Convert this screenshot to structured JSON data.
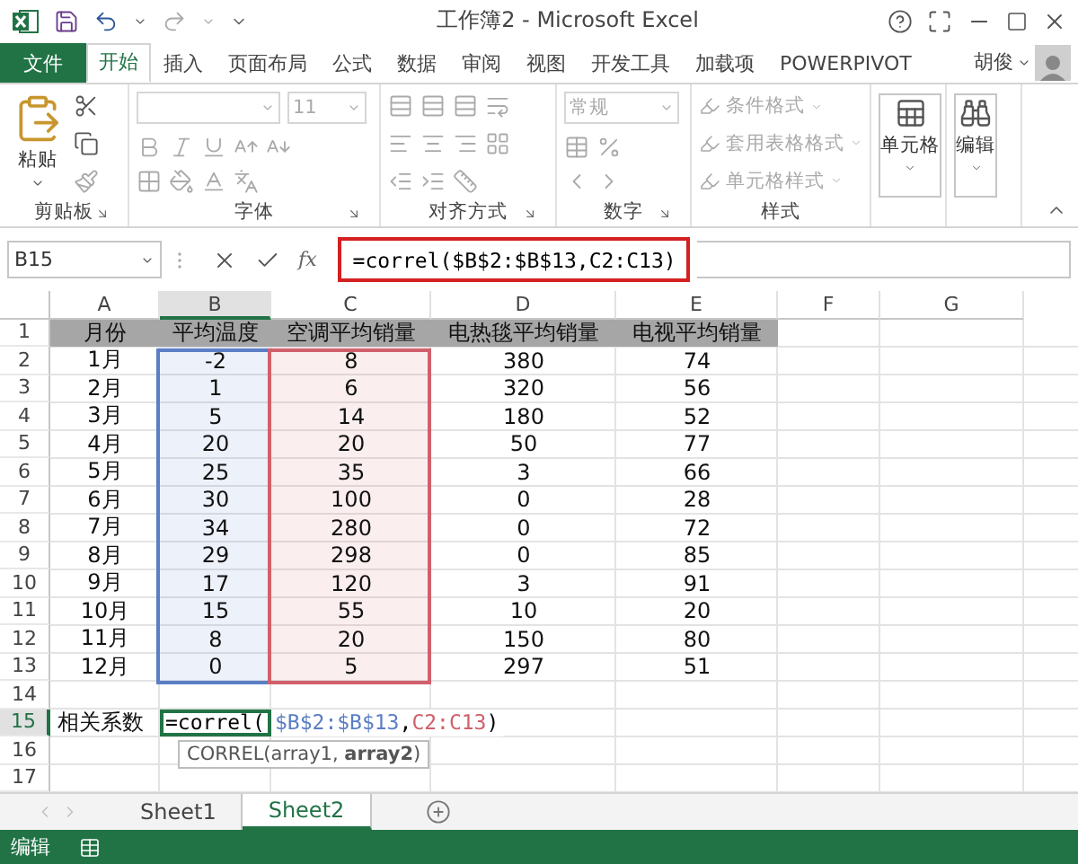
{
  "window": {
    "title": "工作簿2 - Microsoft Excel"
  },
  "ribbon_tabs": [
    {
      "label": "文件",
      "kind": "file",
      "selected": false
    },
    {
      "label": "开始",
      "kind": "tab",
      "selected": true
    },
    {
      "label": "插入",
      "kind": "tab",
      "selected": false
    },
    {
      "label": "页面布局",
      "kind": "tab",
      "selected": false
    },
    {
      "label": "公式",
      "kind": "tab",
      "selected": false
    },
    {
      "label": "数据",
      "kind": "tab",
      "selected": false
    },
    {
      "label": "审阅",
      "kind": "tab",
      "selected": false
    },
    {
      "label": "视图",
      "kind": "tab",
      "selected": false
    },
    {
      "label": "开发工具",
      "kind": "tab",
      "selected": false
    },
    {
      "label": "加载项",
      "kind": "tab",
      "selected": false
    },
    {
      "label": "POWERPIVOT",
      "kind": "tab",
      "selected": false
    }
  ],
  "user": {
    "name": "胡俊"
  },
  "ribbon_groups": [
    {
      "kind": "clipboard",
      "label": "剪贴板",
      "button": "粘贴",
      "disabled": false
    },
    {
      "kind": "font",
      "label": "字体",
      "font_size": "11",
      "disabled": true
    },
    {
      "kind": "alignment",
      "label": "对齐方式",
      "disabled": true
    },
    {
      "kind": "number",
      "label": "数字",
      "format": "常规",
      "disabled": true
    },
    {
      "kind": "styles",
      "label": "样式",
      "items": [
        "条件格式",
        "套用表格格式",
        "单元格样式"
      ],
      "disabled": true
    },
    {
      "kind": "cells",
      "button": "单元格",
      "disabled": false
    },
    {
      "kind": "editing",
      "button": "编辑",
      "disabled": false
    }
  ],
  "formula_bar": {
    "name_box": "B15",
    "fx": "fx",
    "formula": "=correl($B$2:$B$13,C2:C13)"
  },
  "columns": [
    {
      "label": "A",
      "selected": false
    },
    {
      "label": "B",
      "selected": true,
      "color": "#5b7ec4"
    },
    {
      "label": "C",
      "selected": false,
      "color": "#d0606b"
    },
    {
      "label": "D",
      "selected": false
    },
    {
      "label": "E",
      "selected": false
    },
    {
      "label": "F",
      "selected": false
    },
    {
      "label": "G",
      "selected": false
    }
  ],
  "rows": [
    {
      "number": "1",
      "kind": "header",
      "selected": false,
      "cells": [
        "月份",
        "平均温度",
        "空调平均销量",
        "电热毯平均销量",
        "电视平均销量"
      ]
    },
    {
      "number": "2",
      "kind": "data",
      "selected": false,
      "cells": [
        "1月",
        "-2",
        "8",
        "380",
        "74"
      ]
    },
    {
      "number": "3",
      "kind": "data",
      "selected": false,
      "cells": [
        "2月",
        "1",
        "6",
        "320",
        "56"
      ]
    },
    {
      "number": "4",
      "kind": "data",
      "selected": false,
      "cells": [
        "3月",
        "5",
        "14",
        "180",
        "52"
      ]
    },
    {
      "number": "5",
      "kind": "data",
      "selected": false,
      "cells": [
        "4月",
        "20",
        "20",
        "50",
        "77"
      ]
    },
    {
      "number": "6",
      "kind": "data",
      "selected": false,
      "cells": [
        "5月",
        "25",
        "35",
        "3",
        "66"
      ]
    },
    {
      "number": "7",
      "kind": "data",
      "selected": false,
      "cells": [
        "6月",
        "30",
        "100",
        "0",
        "28"
      ]
    },
    {
      "number": "8",
      "kind": "data",
      "selected": false,
      "cells": [
        "7月",
        "34",
        "280",
        "0",
        "72"
      ]
    },
    {
      "number": "9",
      "kind": "data",
      "selected": false,
      "cells": [
        "8月",
        "29",
        "298",
        "0",
        "85"
      ]
    },
    {
      "number": "10",
      "kind": "data",
      "selected": false,
      "cells": [
        "9月",
        "17",
        "120",
        "3",
        "91"
      ]
    },
    {
      "number": "11",
      "kind": "data",
      "selected": false,
      "cells": [
        "10月",
        "15",
        "55",
        "10",
        "20"
      ]
    },
    {
      "number": "12",
      "kind": "data",
      "selected": false,
      "cells": [
        "11月",
        "8",
        "20",
        "150",
        "80"
      ]
    },
    {
      "number": "13",
      "kind": "data",
      "selected": false,
      "cells": [
        "12月",
        "0",
        "5",
        "297",
        "51"
      ]
    },
    {
      "number": "14",
      "kind": "empty",
      "selected": false
    },
    {
      "number": "15",
      "kind": "input",
      "selected": true,
      "label": "相关系数",
      "formula_parts": [
        {
          "text": "=correl(",
          "color": "#000000"
        },
        {
          "text": "$B$2:$B$13",
          "color": "#5b7ec4"
        },
        {
          "text": ",",
          "color": "#000000"
        },
        {
          "text": "C2:C13",
          "color": "#d0606b"
        },
        {
          "text": ")",
          "color": "#000000"
        }
      ],
      "tooltip": "CORREL(array1, **array2**)"
    },
    {
      "number": "16",
      "kind": "empty",
      "selected": false
    },
    {
      "number": "17",
      "kind": "empty",
      "selected": false
    }
  ],
  "sheet_tabs": [
    {
      "label": "Sheet1",
      "selected": false
    },
    {
      "label": "Sheet2",
      "selected": true
    }
  ],
  "status_bar": {
    "mode": "编辑"
  }
}
